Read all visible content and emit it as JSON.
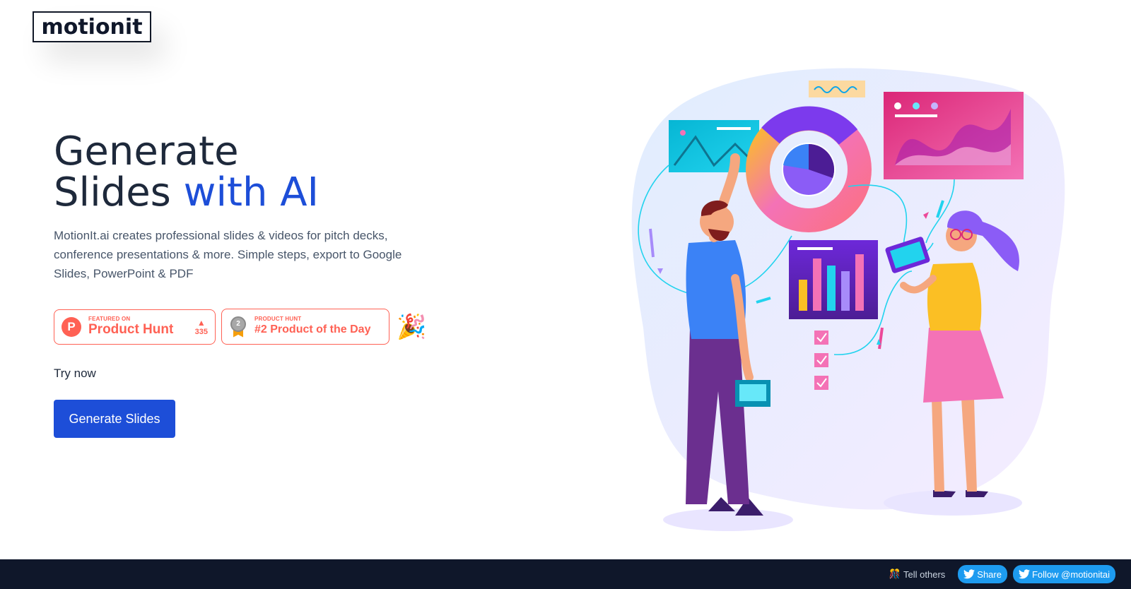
{
  "brand": {
    "logo": "motionit"
  },
  "hero": {
    "title_line1": "Generate",
    "title_line2_plain": "Slides ",
    "title_line2_accent": "with AI",
    "description": "MotionIt.ai creates professional slides & videos for pitch decks, conference presentations & more. Simple steps, export to Google Slides, PowerPoint & PDF"
  },
  "badges": {
    "product_hunt": {
      "small": "FEATURED ON",
      "big": "Product Hunt",
      "votes": "335",
      "icon_letter": "P"
    },
    "product_of_day": {
      "small": "PRODUCT HUNT",
      "big": "#2 Product of the Day",
      "rank": "2"
    },
    "party_emoji": "🎉"
  },
  "cta": {
    "try_now": "Try now",
    "button": "Generate Slides"
  },
  "footer": {
    "tell_others": "Tell others",
    "tell_emoji": "🎊",
    "share": "Share",
    "follow": "Follow @motionitai"
  },
  "colors": {
    "accent": "#1d4ed8",
    "producthunt": "#ff6154",
    "footer_bg": "#0f172a",
    "twitter": "#1d9bf0"
  }
}
